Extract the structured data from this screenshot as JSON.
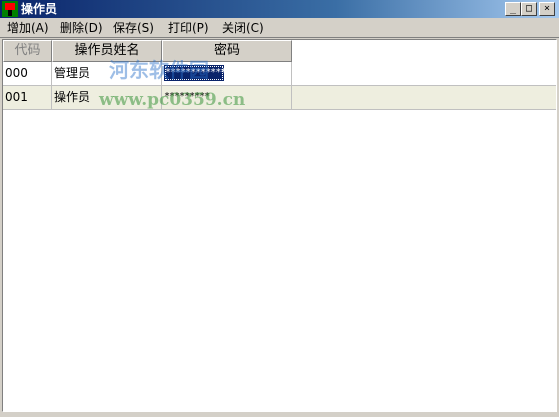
{
  "window": {
    "title": "操作员",
    "min_glyph": "_",
    "max_glyph": "□",
    "close_glyph": "×"
  },
  "menu": {
    "items": [
      {
        "label": "增加(A)"
      },
      {
        "label": "删除(D)"
      },
      {
        "label": "保存(S)"
      },
      {
        "label": "打印(P)"
      },
      {
        "label": "关闭(C)"
      }
    ]
  },
  "grid": {
    "columns": [
      "代码",
      "操作员姓名",
      "密码"
    ],
    "rows": [
      {
        "code": "000",
        "name": "管理员",
        "password": "************",
        "selected": true
      },
      {
        "code": "001",
        "name": "操作员",
        "password": "*********",
        "selected": false
      }
    ]
  },
  "watermark": {
    "text_cn": "河东软件园",
    "text_url": "www.pc0359.cn"
  },
  "colors": {
    "titlebar_start": "#0a246a",
    "titlebar_end": "#a6caf0",
    "selection": "#0a246a",
    "alt_row": "#eeeedf",
    "face": "#d4d0c8"
  }
}
